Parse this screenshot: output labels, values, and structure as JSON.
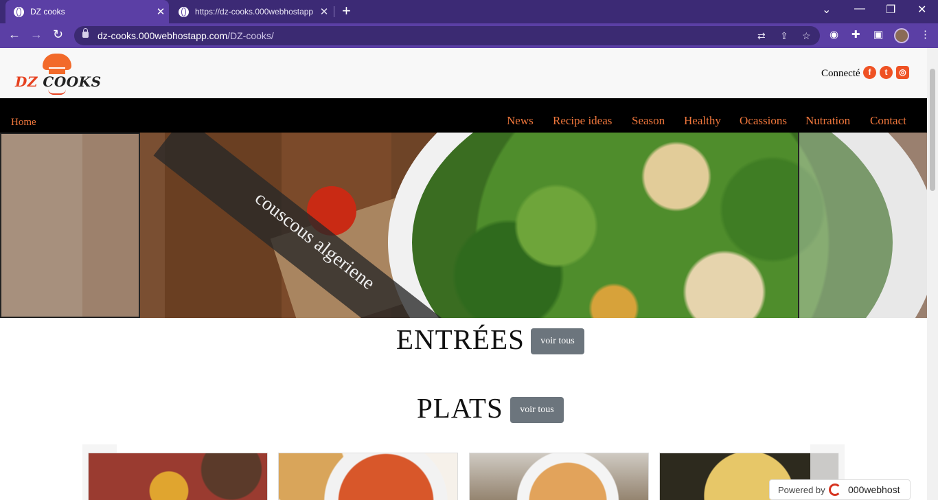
{
  "browser": {
    "tabs": [
      {
        "title": "DZ cooks",
        "active": true
      },
      {
        "title": "https://dz-cooks.000webhostapp",
        "active": false
      }
    ],
    "new_tab": "+",
    "url_host": "dz-cooks.000webhostapp.com",
    "url_path": "/DZ-cooks/",
    "icons": {
      "back": "back-arrow-icon",
      "forward": "forward-arrow-icon",
      "reload": "reload-icon",
      "translate": "translate-icon",
      "share": "share-icon",
      "bookmark": "star-icon",
      "extensions": "puzzle-icon",
      "sidepanel": "side-panel-icon",
      "menu": "kebab-menu-icon"
    },
    "accent": "#5b3fa5",
    "tabbar_color": "#3c2a75"
  },
  "header": {
    "logo_text_dz": "DZ",
    "logo_text_cooks": "COOKS",
    "connect_label": "Connecté",
    "social": [
      {
        "name": "facebook-icon",
        "glyph": "f"
      },
      {
        "name": "twitter-icon",
        "glyph": "t"
      },
      {
        "name": "instagram-icon",
        "glyph": "◎"
      }
    ],
    "accent": "#ef5224"
  },
  "nav": {
    "home": "Home",
    "items": [
      "News",
      "Recipe ideas",
      "Season",
      "Healthy",
      "Ocassions",
      "Nutration",
      "Contact"
    ],
    "link_color": "#f0773c"
  },
  "hero": {
    "caption": "couscous algeriene"
  },
  "sections": {
    "entrees": {
      "title": "ENTRÉES",
      "button": "voir tous"
    },
    "plats": {
      "title": "PLATS",
      "button": "voir tous"
    }
  },
  "badge": {
    "powered": "Powered by",
    "brand": "000webhost"
  }
}
